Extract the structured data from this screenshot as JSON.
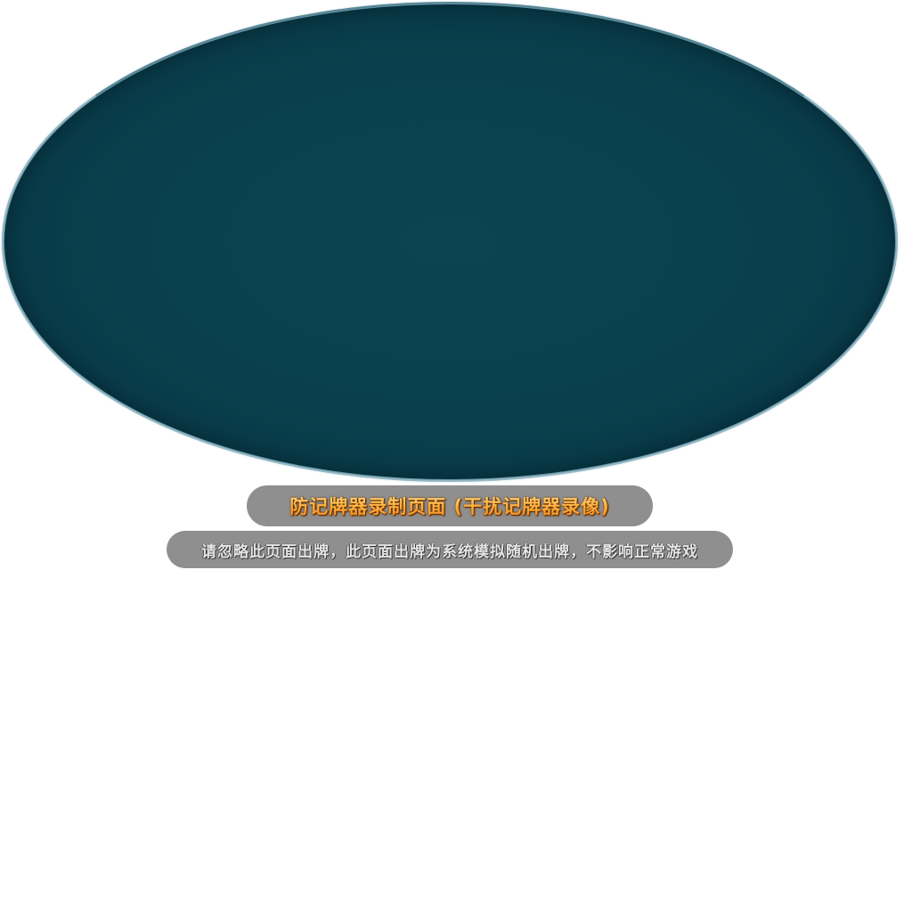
{
  "banner": {
    "title": "防记牌器录制页面 (干扰记牌器录像)",
    "subtitle": "请忽略此页面出牌，此页面出牌为系统模拟随机出牌，不影响正常游戏"
  },
  "colors": {
    "table_felt": "#0a404d",
    "table_rim": "#5f8fa0",
    "pill_background": "#8f8f8f",
    "title_text": "#ffb347",
    "subtitle_text": "#e6e6e6"
  }
}
